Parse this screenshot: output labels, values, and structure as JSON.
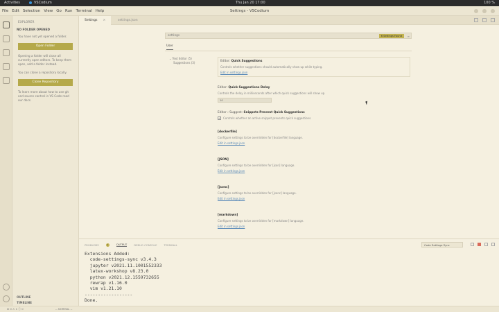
{
  "sysbar": {
    "activities": "Activities",
    "app": "VSCodium",
    "clock": "Thu Jan 20  17:00",
    "tray": "100 %"
  },
  "window": {
    "title": "Settings - VSCodium",
    "menu": [
      "File",
      "Edit",
      "Selection",
      "View",
      "Go",
      "Run",
      "Terminal",
      "Help"
    ]
  },
  "sidebar": {
    "header": "EXPLORER",
    "section": "NO FOLDER OPENED",
    "p1": "You have not yet opened a folder.",
    "open_folder": "Open Folder",
    "p2": "Opening a folder will close all currently open editors. To keep them open, add a folder instead.",
    "p3": "You can clone a repository locally.",
    "clone": "Clone Repository",
    "p4": "To learn more about how to use git and source control in VS Code read our docs.",
    "outline": "OUTLINE",
    "timeline": "TIMELINE"
  },
  "tabs": {
    "active": "Settings",
    "other": "settings.json"
  },
  "settings": {
    "search_value": "settings",
    "search_badge": "6 Settings Found",
    "user_tab": "User",
    "toc": [
      "Text Editor (5)",
      "Suggestions (3)"
    ],
    "items": [
      {
        "category": "Editor:",
        "title": "Quick Suggestions",
        "desc": "Controls whether suggestions should automatically show up while typing.",
        "link": "Edit in settings.json"
      },
      {
        "category": "Editor:",
        "title": "Quick Suggestions Delay",
        "desc": "Controls the delay in milliseconds after which quick suggestions will show up.",
        "value": "10"
      },
      {
        "category": "Editor › Suggest:",
        "title": "Snippets Prevent Quick Suggestions",
        "desc": "Controls whether an active snippet prevents quick suggestions."
      },
      {
        "title": "[dockerfile]",
        "desc": "Configure settings to be overridden for [dockerfile] language.",
        "link": "Edit in settings.json"
      },
      {
        "title": "[JSON]",
        "desc": "Configure settings to be overridden for [json] language.",
        "link": "Edit in settings.json"
      },
      {
        "title": "[jsonc]",
        "desc": "Configure settings to be overridden for [jsonc] language.",
        "link": "Edit in settings.json"
      },
      {
        "title": "[markdown]",
        "desc": "Configure settings to be overridden for [markdown] language.",
        "link": "Edit in settings.json"
      }
    ]
  },
  "panel": {
    "tabs": [
      "PROBLEMS",
      "OUTPUT",
      "DEBUG CONSOLE",
      "TERMINAL"
    ],
    "problems_count": "1",
    "channel": "Code Settings Sync",
    "lines": [
      "Extensions Added:",
      "  code-settings-sync v3.4.3",
      "  jupyter v2021.11.1001552333",
      "  latex-workshop v8.23.0",
      "  python v2021.12.1559732655",
      "  rewrap v1.16.0",
      "  vim v1.21.10",
      "------------------",
      "Done."
    ]
  },
  "statusbar": {
    "left": "⊗ 0  ⚠ 1  ⓘ 0",
    "right": "-- NORMAL --"
  }
}
